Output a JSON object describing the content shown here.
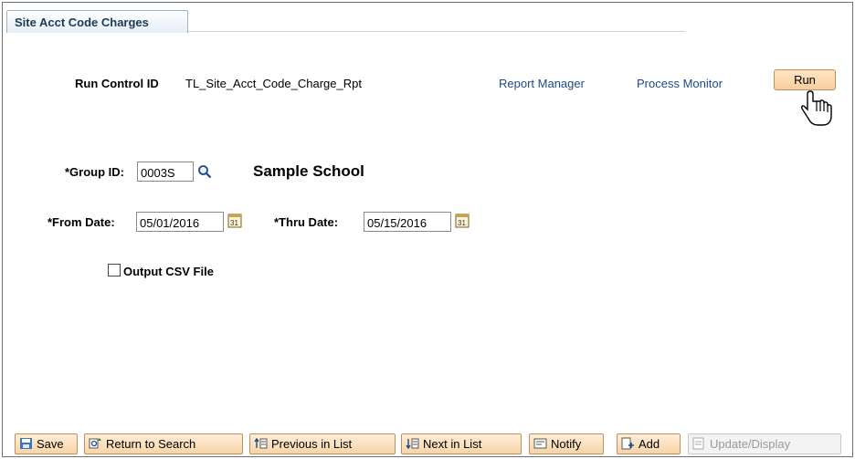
{
  "tab": {
    "label": "Site Acct Code Charges"
  },
  "header": {
    "run_control_label": "Run Control ID",
    "run_control_value": "TL_Site_Acct_Code_Charge_Rpt",
    "report_manager": "Report Manager",
    "process_monitor": "Process Monitor",
    "run_button": "Run"
  },
  "form": {
    "group_id_label": "*Group ID:",
    "group_id_value": "0003S",
    "school_name": "Sample School",
    "from_date_label": "*From Date:",
    "from_date_value": "05/01/2016",
    "thru_date_label": "*Thru Date:",
    "thru_date_value": "05/15/2016",
    "csv_label": "Output CSV File",
    "csv_checked": false
  },
  "toolbar": {
    "save": "Save",
    "return_to_search": "Return to Search",
    "previous_in_list": "Previous in List",
    "next_in_list": "Next in List",
    "notify": "Notify",
    "add": "Add",
    "update_display": "Update/Display"
  },
  "colors": {
    "link": "#1c4a8a",
    "button_bg": "#f8cf9f",
    "button_border": "#b9925a"
  }
}
